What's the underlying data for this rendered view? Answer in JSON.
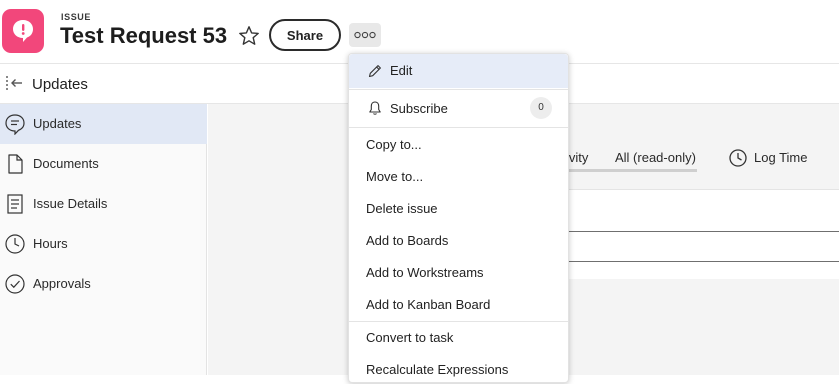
{
  "header": {
    "object_type": "ISSUE",
    "title": "Test Request 53",
    "share_label": "Share",
    "icons": {
      "app": "issue-chat-icon",
      "favorite": "star-icon",
      "more": "more-ellipsis-icon"
    }
  },
  "subbar": {
    "title": "Updates",
    "icon": "collapse-panel-icon"
  },
  "sidebar": {
    "items": [
      {
        "label": "Updates",
        "icon": "chat-bubble-icon",
        "active": true
      },
      {
        "label": "Documents",
        "icon": "document-icon",
        "active": false
      },
      {
        "label": "Issue Details",
        "icon": "details-icon",
        "active": false
      },
      {
        "label": "Hours",
        "icon": "clock-icon",
        "active": false
      },
      {
        "label": "Approvals",
        "icon": "check-circle-icon",
        "active": false
      }
    ]
  },
  "main": {
    "tab_partial": "ivity",
    "tab_all": "All (read-only)",
    "log_time_label": "Log Time"
  },
  "menu": {
    "edit_label": "Edit",
    "subscribe_label": "Subscribe",
    "subscribe_count": "0",
    "items": [
      "Copy to...",
      "Move to...",
      "Delete issue",
      "Add to Boards",
      "Add to Workstreams",
      "Add to Kanban Board",
      "Convert to task",
      "Recalculate Expressions"
    ]
  },
  "colors": {
    "brand_pink": "#f2477b",
    "active_nav": "#e1e8f5",
    "menu_highlight": "#e6ecf8"
  }
}
